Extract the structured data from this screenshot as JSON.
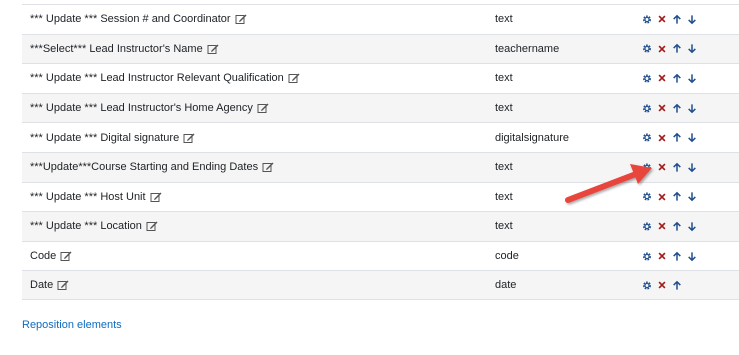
{
  "table": {
    "rows": [
      {
        "name": "*** Update *** Session # and Coordinator",
        "type": "text",
        "move_down": true
      },
      {
        "name": "***Select*** Lead Instructor's Name",
        "type": "teachername",
        "move_down": true
      },
      {
        "name": "*** Update *** Lead Instructor Relevant Qualification",
        "type": "text",
        "move_down": true
      },
      {
        "name": "*** Update *** Lead Instructor's Home Agency",
        "type": "text",
        "move_down": true
      },
      {
        "name": "*** Update *** Digital signature",
        "type": "digitalsignature",
        "move_down": true
      },
      {
        "name": "***Update***Course Starting and Ending Dates",
        "type": "text",
        "move_down": true
      },
      {
        "name": "*** Update *** Host Unit",
        "type": "text",
        "move_down": true
      },
      {
        "name": "*** Update *** Location",
        "type": "text",
        "move_down": true
      },
      {
        "name": "Code",
        "type": "code",
        "move_down": true
      },
      {
        "name": "Date",
        "type": "date",
        "move_down": false
      }
    ]
  },
  "footer": {
    "reposition_label": "Reposition elements"
  },
  "icons": {
    "edit": "edit-icon",
    "settings": "gear-icon",
    "delete": "close-icon",
    "move_up": "arrow-up-icon",
    "move_down": "arrow-down-icon"
  },
  "colors": {
    "link": "#0f6cbf",
    "delete": "#a41a1a",
    "settings": "#1f4e8c",
    "annotation": "#e8453c"
  }
}
